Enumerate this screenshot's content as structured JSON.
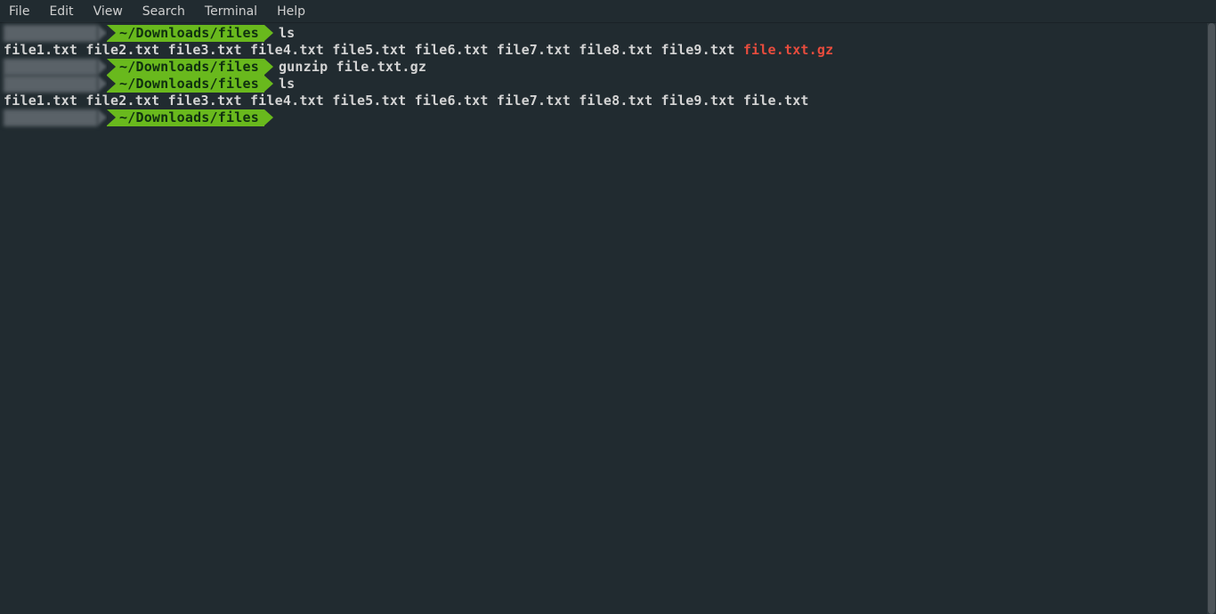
{
  "menubar": {
    "items": [
      "File",
      "Edit",
      "View",
      "Search",
      "Terminal",
      "Help"
    ]
  },
  "terminal": {
    "path": "~/Downloads/files",
    "sessions": [
      {
        "command": "ls",
        "output_files": [
          {
            "name": "file1.txt",
            "type": "normal"
          },
          {
            "name": "file2.txt",
            "type": "normal"
          },
          {
            "name": "file3.txt",
            "type": "normal"
          },
          {
            "name": "file4.txt",
            "type": "normal"
          },
          {
            "name": "file5.txt",
            "type": "normal"
          },
          {
            "name": "file6.txt",
            "type": "normal"
          },
          {
            "name": "file7.txt",
            "type": "normal"
          },
          {
            "name": "file8.txt",
            "type": "normal"
          },
          {
            "name": "file9.txt",
            "type": "normal"
          },
          {
            "name": "file.txt.gz",
            "type": "archive"
          }
        ]
      },
      {
        "command": "gunzip file.txt.gz",
        "output_files": []
      },
      {
        "command": "ls",
        "output_files": [
          {
            "name": "file1.txt",
            "type": "normal"
          },
          {
            "name": "file2.txt",
            "type": "normal"
          },
          {
            "name": "file3.txt",
            "type": "normal"
          },
          {
            "name": "file4.txt",
            "type": "normal"
          },
          {
            "name": "file5.txt",
            "type": "normal"
          },
          {
            "name": "file6.txt",
            "type": "normal"
          },
          {
            "name": "file7.txt",
            "type": "normal"
          },
          {
            "name": "file8.txt",
            "type": "normal"
          },
          {
            "name": "file9.txt",
            "type": "normal"
          },
          {
            "name": "file.txt",
            "type": "normal"
          }
        ]
      },
      {
        "command": "",
        "output_files": []
      }
    ]
  }
}
